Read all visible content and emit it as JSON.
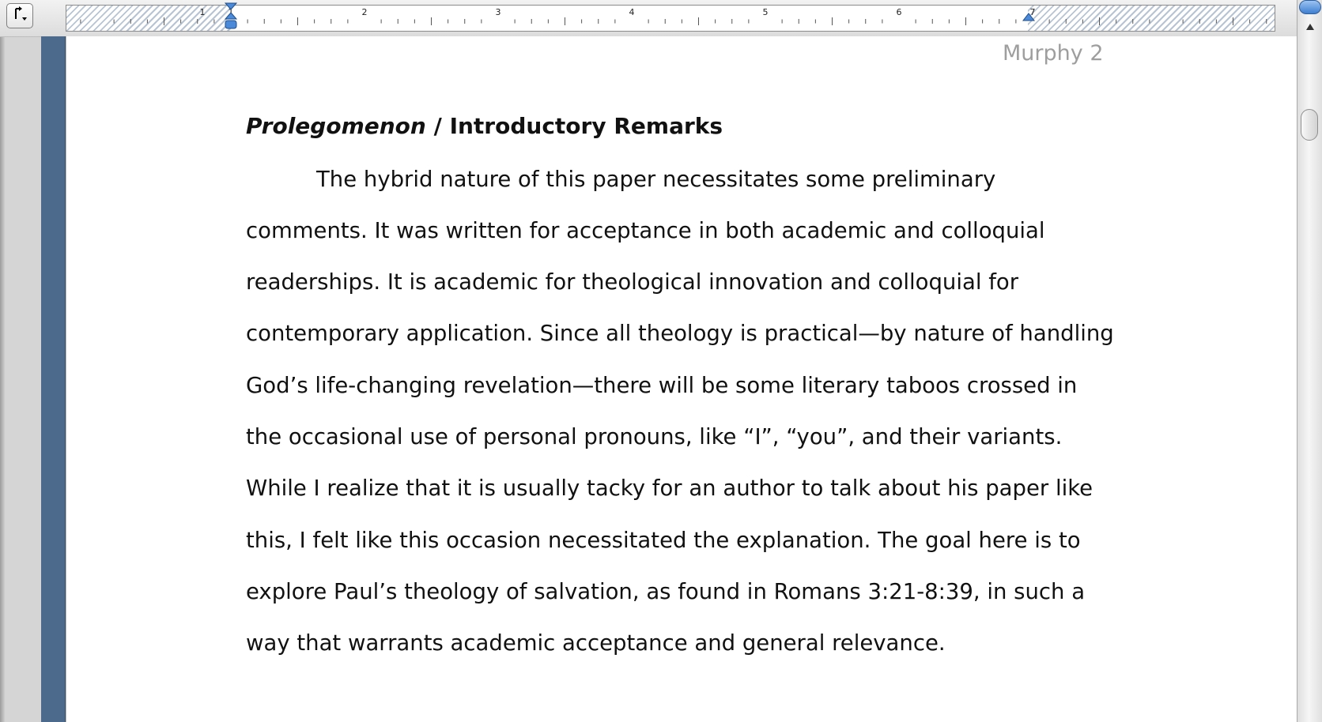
{
  "ruler": {
    "labels": [
      "1",
      "1",
      "2",
      "3",
      "4",
      "5",
      "6",
      "7"
    ]
  },
  "document": {
    "running_header": "Murphy 2",
    "heading": {
      "italic": "Prolegomenon",
      "rest": " / Introductory Remarks"
    },
    "body_lines": [
      "The hybrid nature of this paper necessitates some preliminary",
      "comments. It was written for acceptance in both academic and colloquial",
      "readerships. It is academic for theological innovation and colloquial for",
      "contemporary application. Since all theology is practical—by nature of handling",
      "God’s life-changing revelation—there will be some literary taboos crossed in",
      "the occasional use of personal pronouns, like “I”, “you”, and their variants.",
      "While I realize that it is usually tacky for an author to talk about his paper like",
      "this, I felt like this occasion necessitated the explanation. The goal here is to",
      "explore Paul’s theology of salvation, as found in Romans 3:21-8:39, in such a",
      "way that warrants academic acceptance and general relevance."
    ]
  },
  "colors": {
    "page_background": "#ffffff",
    "left_bar": "#4c6b8c",
    "header_text": "#9e9e9e",
    "body_text": "#111111"
  },
  "icons": {
    "tab_selector": "left-tab-stop-icon",
    "first_line_indent": "first-line-indent-marker-icon",
    "right_indent": "right-indent-marker-icon",
    "scroll_up": "scroll-up-arrow-icon"
  }
}
